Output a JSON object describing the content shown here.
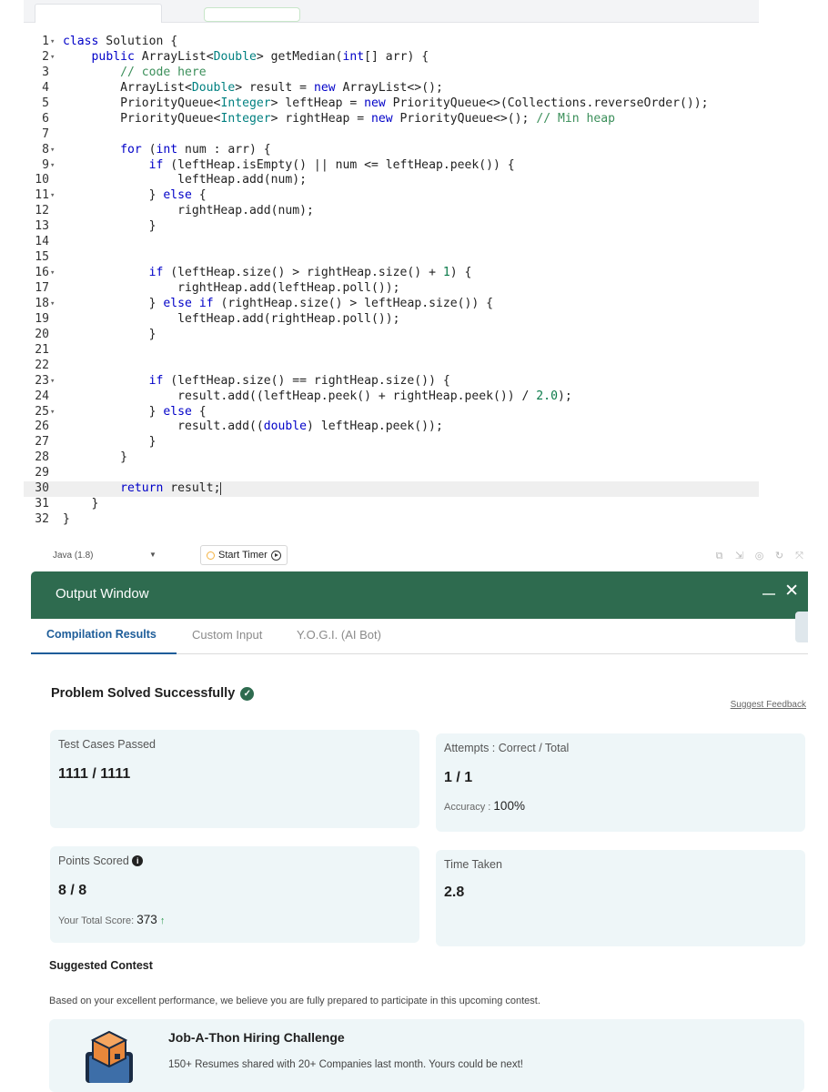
{
  "editor": {
    "lines": [
      {
        "n": "1",
        "fold": true,
        "html": "<span style=\"color:#0000c8\">class</span> Solution {"
      },
      {
        "n": "2",
        "fold": true,
        "html": "    <span style=\"color:#0000c8\">public</span> ArrayList&lt;<span style=\"color:#008080\">Double</span>&gt; getMedian(<span style=\"color:#0000c8\">int</span>[] arr) {"
      },
      {
        "n": "3",
        "fold": false,
        "html": "        <span style=\"color:#3b8f5a\">// code here</span>"
      },
      {
        "n": "4",
        "fold": false,
        "html": "        ArrayList&lt;<span style=\"color:#008080\">Double</span>&gt; result = <span style=\"color:#0000c8\">new</span> ArrayList&lt;&gt;();"
      },
      {
        "n": "5",
        "fold": false,
        "html": "        PriorityQueue&lt;<span style=\"color:#008080\">Integer</span>&gt; leftHeap = <span style=\"color:#0000c8\">new</span> PriorityQueue&lt;&gt;(Collections.reverseOrder());"
      },
      {
        "n": "6",
        "fold": false,
        "html": "        PriorityQueue&lt;<span style=\"color:#008080\">Integer</span>&gt; rightHeap = <span style=\"color:#0000c8\">new</span> PriorityQueue&lt;&gt;(); <span style=\"color:#3b8f5a\">// Min heap</span>"
      },
      {
        "n": "7",
        "fold": false,
        "html": ""
      },
      {
        "n": "8",
        "fold": true,
        "html": "        <span style=\"color:#0000c8\">for</span> (<span style=\"color:#0000c8\">int</span> num : arr) {"
      },
      {
        "n": "9",
        "fold": true,
        "html": "            <span style=\"color:#0000c8\">if</span> (leftHeap.isEmpty() || num &lt;= leftHeap.peek()) {"
      },
      {
        "n": "10",
        "fold": false,
        "html": "                leftHeap.add(num);"
      },
      {
        "n": "11",
        "fold": true,
        "html": "            } <span style=\"color:#0000c8\">else</span> {"
      },
      {
        "n": "12",
        "fold": false,
        "html": "                rightHeap.add(num);"
      },
      {
        "n": "13",
        "fold": false,
        "html": "            }"
      },
      {
        "n": "14",
        "fold": false,
        "html": ""
      },
      {
        "n": "15",
        "fold": false,
        "html": ""
      },
      {
        "n": "16",
        "fold": true,
        "html": "            <span style=\"color:#0000c8\">if</span> (leftHeap.size() &gt; rightHeap.size() + <span style=\"color:#0b7a4a\">1</span>) {"
      },
      {
        "n": "17",
        "fold": false,
        "html": "                rightHeap.add(leftHeap.poll());"
      },
      {
        "n": "18",
        "fold": true,
        "html": "            } <span style=\"color:#0000c8\">else</span> <span style=\"color:#0000c8\">if</span> (rightHeap.size() &gt; leftHeap.size()) {"
      },
      {
        "n": "19",
        "fold": false,
        "html": "                leftHeap.add(rightHeap.poll());"
      },
      {
        "n": "20",
        "fold": false,
        "html": "            }"
      },
      {
        "n": "21",
        "fold": false,
        "html": ""
      },
      {
        "n": "22",
        "fold": false,
        "html": ""
      },
      {
        "n": "23",
        "fold": true,
        "html": "            <span style=\"color:#0000c8\">if</span> (leftHeap.size() == rightHeap.size()) {"
      },
      {
        "n": "24",
        "fold": false,
        "html": "                result.add((leftHeap.peek() + rightHeap.peek()) / <span style=\"color:#0b7a4a\">2.0</span>);"
      },
      {
        "n": "25",
        "fold": true,
        "html": "            } <span style=\"color:#0000c8\">else</span> {"
      },
      {
        "n": "26",
        "fold": false,
        "html": "                result.add((<span style=\"color:#0000c8\">double</span>) leftHeap.peek());"
      },
      {
        "n": "27",
        "fold": false,
        "html": "            }"
      },
      {
        "n": "28",
        "fold": false,
        "html": "        }"
      },
      {
        "n": "29",
        "fold": false,
        "html": ""
      },
      {
        "n": "30",
        "fold": false,
        "active": true,
        "html": "        <span style=\"color:#0000c8\">return</span> result;<span class=\"cursor\"></span>"
      },
      {
        "n": "31",
        "fold": false,
        "html": "    }"
      },
      {
        "n": "32",
        "fold": false,
        "html": "}"
      }
    ]
  },
  "toolbar": {
    "language": "Java (1.8)",
    "start_timer": "Start Timer"
  },
  "output": {
    "title": "Output Window",
    "tabs": [
      "Compilation Results",
      "Custom Input",
      "Y.O.G.I. (AI Bot)"
    ],
    "status": "Problem Solved Successfully",
    "feedback": "Suggest Feedback",
    "tests_label": "Test Cases Passed",
    "tests_value": "1111 / 1111",
    "attempts_label": "Attempts : Correct / Total",
    "attempts_value": "1 / 1",
    "accuracy_label": "Accuracy :",
    "accuracy_value": "100%",
    "points_label": "Points Scored",
    "points_value": "8 / 8",
    "total_label": "Your Total Score:",
    "total_value": "373",
    "time_label": "Time Taken",
    "time_value": "2.8"
  },
  "contest": {
    "heading": "Suggested Contest",
    "desc": "Based on your excellent performance, we believe you are fully prepared to participate in this upcoming contest.",
    "name": "Job-A-Thon Hiring Challenge",
    "sub": "150+ Resumes shared with 20+ Companies last month. Yours could be next!"
  }
}
